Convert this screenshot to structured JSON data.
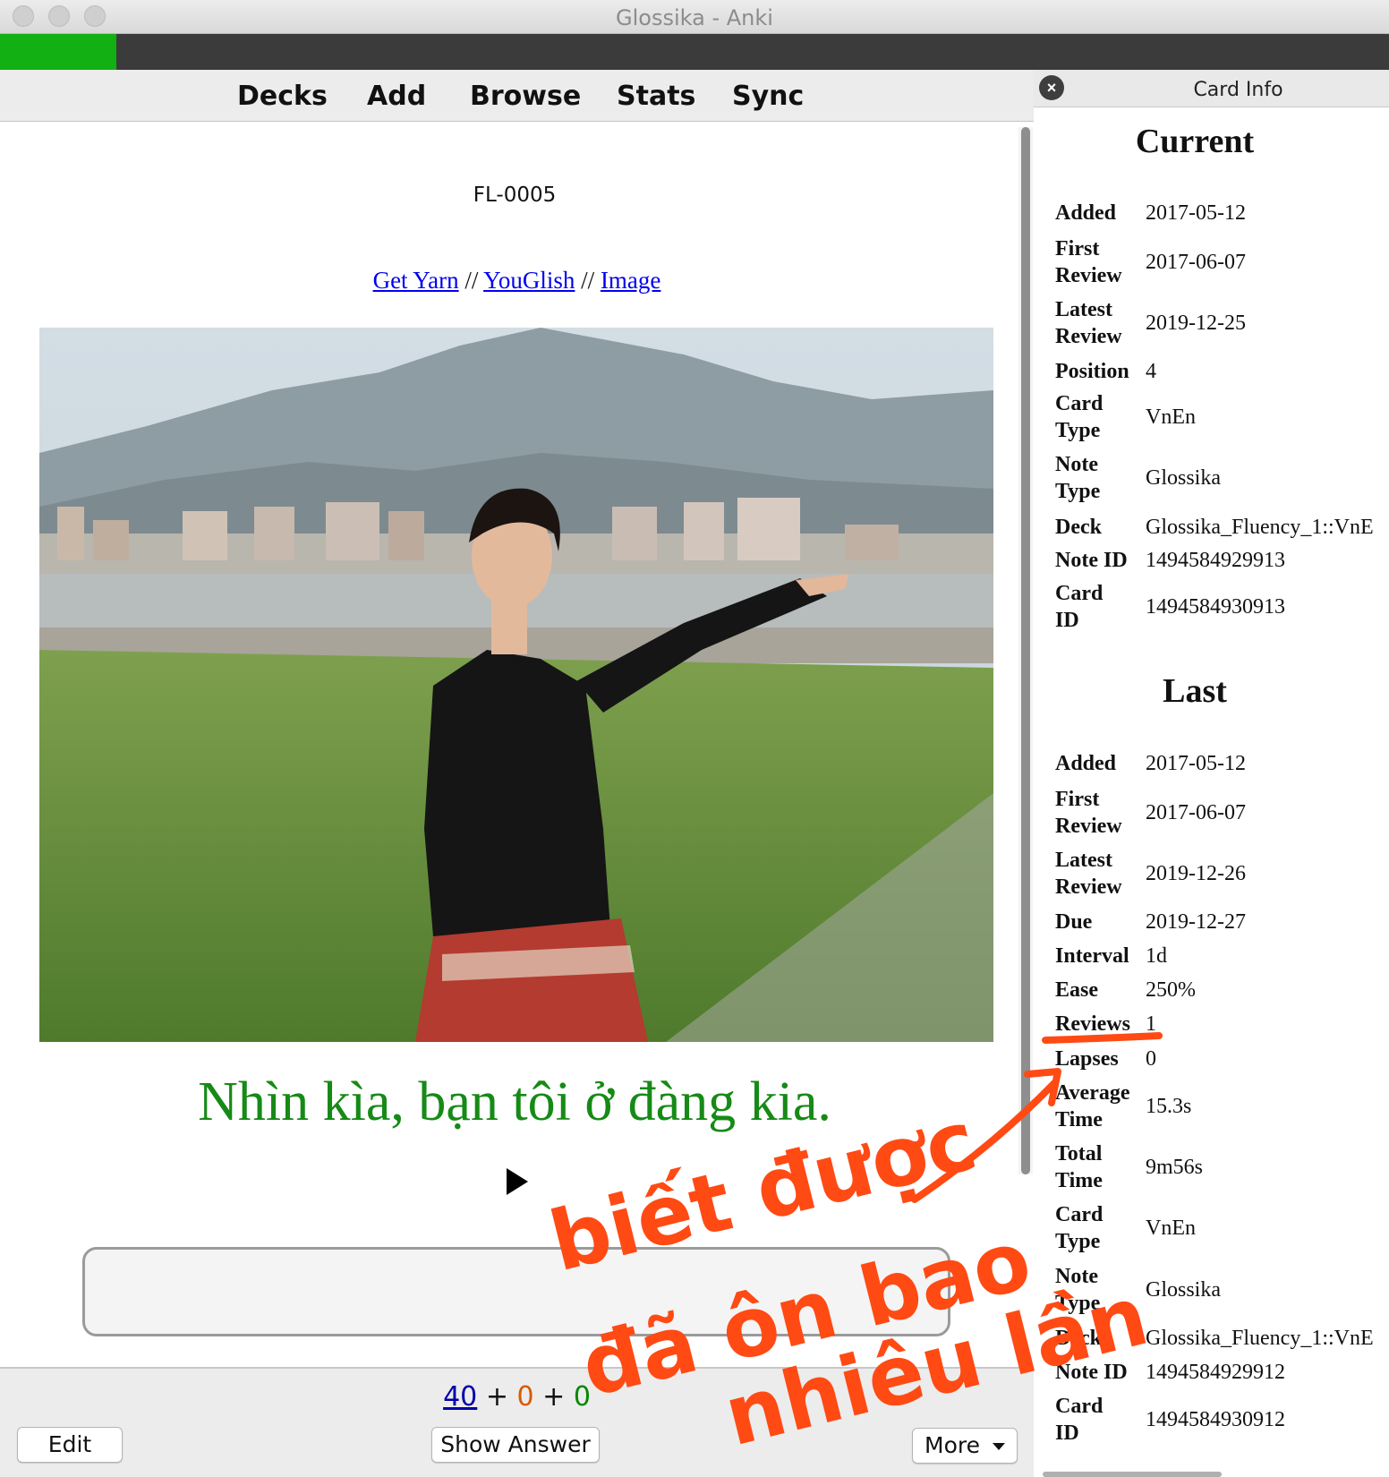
{
  "window": {
    "title": "Glossika - Anki"
  },
  "progress": {
    "fraction": 0.084
  },
  "toolbar": {
    "decks": "Decks",
    "add": "Add",
    "browse": "Browse",
    "stats": "Stats",
    "sync": "Sync"
  },
  "card": {
    "id_label": "FL-0005",
    "links": {
      "yarn": "Get Yarn",
      "sep1": " // ",
      "youglish": "YouGlish",
      "sep2": " // ",
      "image": "Image"
    },
    "sentence": "Nhìn kìa, bạn tôi ở đàng kia."
  },
  "counts": {
    "new": "40",
    "plus1": " + ",
    "learning": "0",
    "plus2": " + ",
    "review": "0"
  },
  "buttons": {
    "edit": "Edit",
    "show_answer": "Show Answer",
    "more": "More"
  },
  "info_panel": {
    "title": "Card Info",
    "current": {
      "heading": "Current",
      "rows": [
        {
          "label": "Added",
          "value": "2017-05-12"
        },
        {
          "label": "First\nReview",
          "value": "2017-06-07"
        },
        {
          "label": "Latest\nReview",
          "value": "2019-12-25"
        },
        {
          "label": "Position",
          "value": "4"
        },
        {
          "label": "Card\nType",
          "value": "VnEn"
        },
        {
          "label": "Note\nType",
          "value": "Glossika"
        },
        {
          "label": "Deck",
          "value": "Glossika_Fluency_1::VnE"
        },
        {
          "label": "Note ID",
          "value": "1494584929913"
        },
        {
          "label": "Card\nID",
          "value": "1494584930913"
        }
      ]
    },
    "last": {
      "heading": "Last",
      "rows": [
        {
          "label": "Added",
          "value": "2017-05-12"
        },
        {
          "label": "First\nReview",
          "value": "2017-06-07"
        },
        {
          "label": "Latest\nReview",
          "value": "2019-12-26"
        },
        {
          "label": "Due",
          "value": "2019-12-27"
        },
        {
          "label": "Interval",
          "value": "1d"
        },
        {
          "label": "Ease",
          "value": "250%"
        },
        {
          "label": "Reviews",
          "value": "1"
        },
        {
          "label": "Lapses",
          "value": "0"
        },
        {
          "label": "Average\nTime",
          "value": "15.3s"
        },
        {
          "label": "Total\nTime",
          "value": "9m56s"
        },
        {
          "label": "Card\nType",
          "value": "VnEn"
        },
        {
          "label": "Note\nType",
          "value": "Glossika"
        },
        {
          "label": "Deck",
          "value": "Glossika_Fluency_1::VnE"
        },
        {
          "label": "Note ID",
          "value": "1494584929912"
        },
        {
          "label": "Card\nID",
          "value": "1494584930912"
        }
      ]
    }
  },
  "annotation": {
    "line1": "biết được",
    "line2": "đã ôn bao",
    "line3": "nhiêu lần",
    "color": "#ff4a14"
  }
}
